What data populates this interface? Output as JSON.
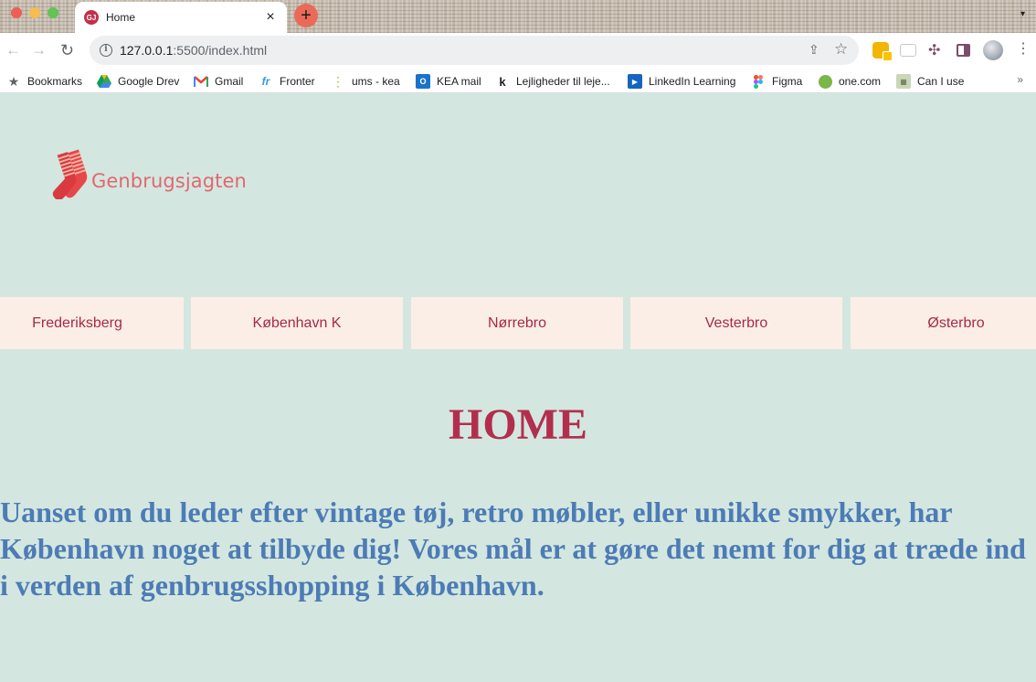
{
  "browser": {
    "tab_title": "Home",
    "tab_favicon_text": "GJ",
    "url_host": "127.0.0.1",
    "url_rest": ":5500/index.html",
    "icons": {
      "back": "arrow-left-icon",
      "forward": "arrow-right-icon",
      "reload": "reload-icon",
      "info": "info-icon",
      "share": "share-icon",
      "star": "star-icon",
      "menu": "kebab-menu-icon"
    }
  },
  "bookmarks": {
    "items": [
      {
        "label": "Bookmarks",
        "icon": "star-icon"
      },
      {
        "label": "Google Drev",
        "icon": "google-drive-icon"
      },
      {
        "label": "Gmail",
        "icon": "gmail-icon"
      },
      {
        "label": "Fronter",
        "icon": "fronter-icon"
      },
      {
        "label": "ums - kea",
        "icon": "dots-icon"
      },
      {
        "label": "KEA mail",
        "icon": "outlook-icon"
      },
      {
        "label": "Lejligheder til leje...",
        "icon": "k-icon"
      },
      {
        "label": "LinkedIn Learning",
        "icon": "play-icon"
      },
      {
        "label": "Figma",
        "icon": "figma-icon"
      },
      {
        "label": "one.com",
        "icon": "green-circle-icon"
      },
      {
        "label": "Can I use",
        "icon": "caniuse-icon"
      }
    ],
    "more": "»"
  },
  "site": {
    "logo_text": "Genbrugsjagten",
    "nav": [
      "Frederiksberg",
      "København K",
      "Nørrebro",
      "Vesterbro",
      "Østerbro"
    ],
    "heading": "HOME",
    "intro": "Uanset om du leder efter vintage tøj, retro møbler, eller unikke smykker, har København noget at tilbyde dig! Vores mål er at gøre det nemt for dig at træde ind i verden af genbrugsshopping i København."
  },
  "colors": {
    "page_bg": "#d3e7e0",
    "nav_bg": "#fbeee6",
    "nav_text": "#a62a44",
    "heading": "#b32e4d",
    "intro_text": "#4d7bb5",
    "logo_text": "#e0686f"
  }
}
